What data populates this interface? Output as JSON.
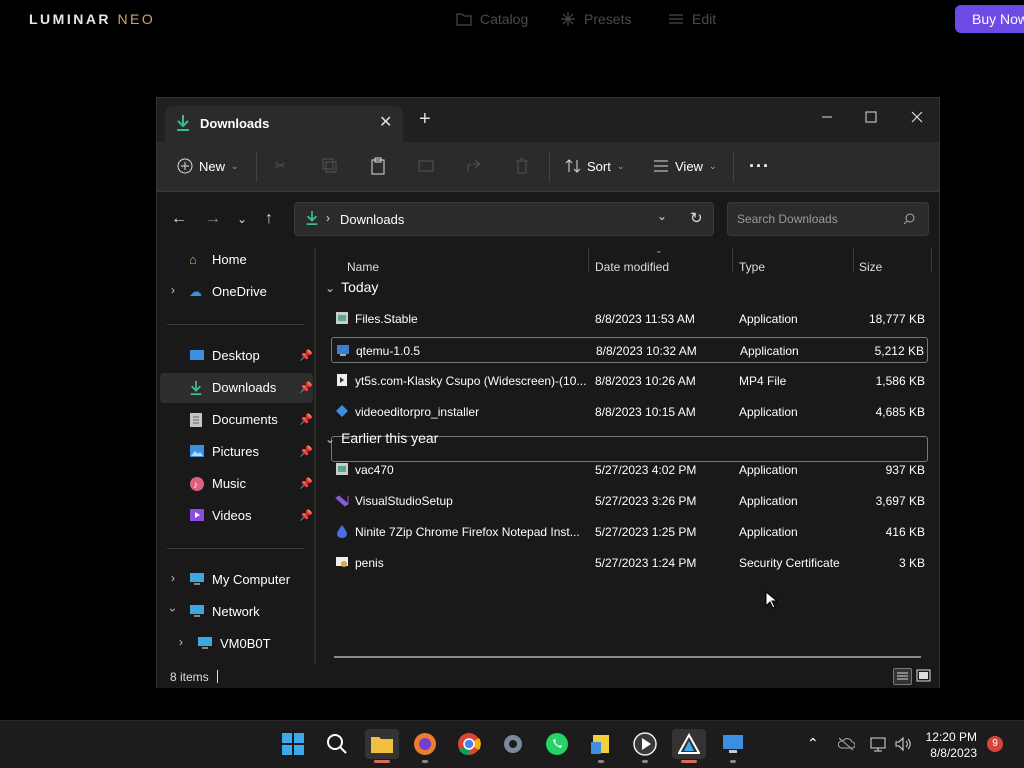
{
  "app": {
    "logo_main": "LUMINAR",
    "logo_neo": "NEO",
    "nav": [
      {
        "label": "Catalog",
        "icon": "folder-icon"
      },
      {
        "label": "Presets",
        "icon": "sparkle-icon"
      },
      {
        "label": "Edit",
        "icon": "sliders-icon"
      }
    ],
    "buy_label": "Buy Now",
    "accent": "#6b4ae6"
  },
  "explorer": {
    "tab_title": "Downloads",
    "toolbar": {
      "new_label": "New",
      "sort_label": "Sort",
      "view_label": "View"
    },
    "address": "Downloads",
    "search_placeholder": "Search Downloads",
    "sidebar": {
      "home": "Home",
      "onedrive": "OneDrive",
      "pinned": [
        {
          "label": "Desktop"
        },
        {
          "label": "Downloads"
        },
        {
          "label": "Documents"
        },
        {
          "label": "Pictures"
        },
        {
          "label": "Music"
        },
        {
          "label": "Videos"
        }
      ],
      "my_computer": "My Computer",
      "network": "Network",
      "network_child": "VM0B0T"
    },
    "columns": {
      "name": "Name",
      "date": "Date modified",
      "type": "Type",
      "size": "Size"
    },
    "groups": [
      {
        "label": "Today",
        "rows": [
          {
            "name": "Files.Stable",
            "date": "8/8/2023 11:53 AM",
            "type": "Application",
            "size": "18,777 KB",
            "icon": "app-icon"
          },
          {
            "name": "qtemu-1.0.5",
            "date": "8/8/2023 10:32 AM",
            "type": "Application",
            "size": "5,212 KB",
            "icon": "app-icon"
          },
          {
            "name": "yt5s.com-Klasky Csupo (Widescreen)-(10...",
            "date": "8/8/2023 10:26 AM",
            "type": "MP4 File",
            "size": "1,586 KB",
            "icon": "video-file-icon"
          },
          {
            "name": "videoeditorpro_installer",
            "date": "8/8/2023 10:15 AM",
            "type": "Application",
            "size": "4,685 KB",
            "icon": "installer-icon"
          }
        ]
      },
      {
        "label": "Earlier this year",
        "rows": [
          {
            "name": "vac470",
            "date": "5/27/2023 4:02 PM",
            "type": "Application",
            "size": "937 KB",
            "icon": "app-icon"
          },
          {
            "name": "VisualStudioSetup",
            "date": "5/27/2023 3:26 PM",
            "type": "Application",
            "size": "3,697 KB",
            "icon": "visual-studio-icon"
          },
          {
            "name": "Ninite 7Zip Chrome Firefox Notepad Inst...",
            "date": "5/27/2023 1:25 PM",
            "type": "Application",
            "size": "416 KB",
            "icon": "ninite-icon"
          },
          {
            "name": "penis",
            "date": "5/27/2023 1:24 PM",
            "type": "Security Certificate",
            "size": "3 KB",
            "icon": "certificate-icon"
          }
        ]
      }
    ],
    "status": "8 items"
  },
  "taskbar": {
    "time": "12:20 PM",
    "date": "8/8/2023",
    "notifications": "9"
  }
}
